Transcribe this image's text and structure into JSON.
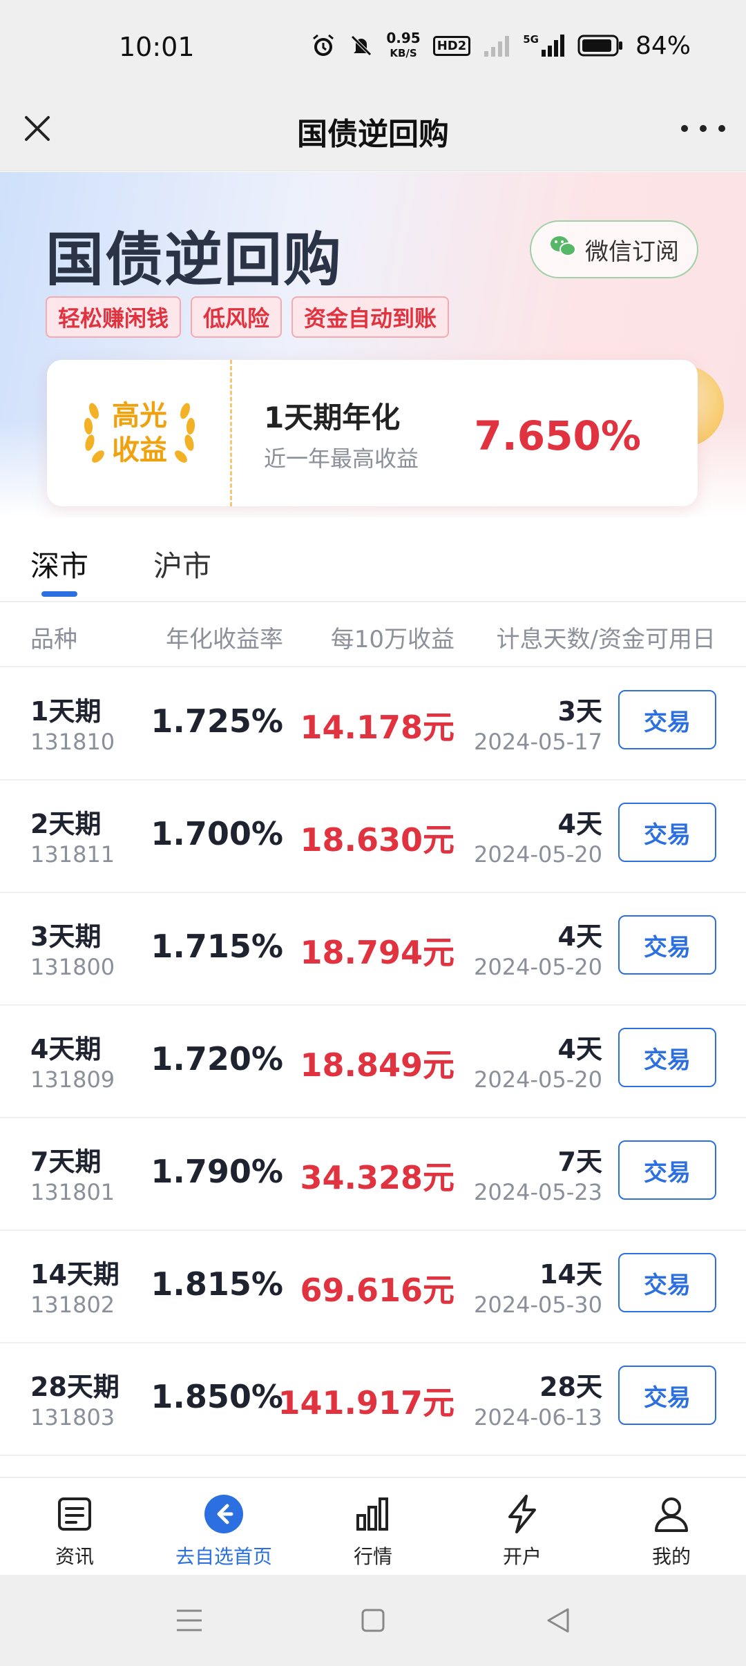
{
  "status_bar": {
    "time": "10:01",
    "speed_value": "0.95",
    "speed_unit": "KB/S",
    "hd_label": "HD2",
    "network_label": "5G",
    "battery": "84%"
  },
  "header": {
    "title": "国债逆回购"
  },
  "banner": {
    "title": "国债逆回购",
    "wechat_label": "微信订阅",
    "tags": [
      "轻松赚闲钱",
      "低风险",
      "资金自动到账"
    ],
    "badge_line1": "高光",
    "badge_line2": "收益",
    "yield_label": "1天期年化",
    "yield_sub": "近一年最高收益",
    "yield_rate": "7.650%"
  },
  "markets": {
    "tabs": [
      "深市",
      "沪市"
    ],
    "active_tab": "深市"
  },
  "table": {
    "headers": [
      "品种",
      "年化收益率",
      "每10万收益",
      "计息天数/资金可用日"
    ],
    "trade_label": "交易",
    "rows": [
      {
        "name": "1天期",
        "code": "131810",
        "rate": "1.725%",
        "income": "14.178元",
        "days": "3天",
        "date": "2024-05-17"
      },
      {
        "name": "2天期",
        "code": "131811",
        "rate": "1.700%",
        "income": "18.630元",
        "days": "4天",
        "date": "2024-05-20"
      },
      {
        "name": "3天期",
        "code": "131800",
        "rate": "1.715%",
        "income": "18.794元",
        "days": "4天",
        "date": "2024-05-20"
      },
      {
        "name": "4天期",
        "code": "131809",
        "rate": "1.720%",
        "income": "18.849元",
        "days": "4天",
        "date": "2024-05-20"
      },
      {
        "name": "7天期",
        "code": "131801",
        "rate": "1.790%",
        "income": "34.328元",
        "days": "7天",
        "date": "2024-05-23"
      },
      {
        "name": "14天期",
        "code": "131802",
        "rate": "1.815%",
        "income": "69.616元",
        "days": "14天",
        "date": "2024-05-30"
      },
      {
        "name": "28天期",
        "code": "131803",
        "rate": "1.850%",
        "income": "141.917元",
        "days": "28天",
        "date": "2024-06-13"
      }
    ]
  },
  "bottom_nav": {
    "items": [
      {
        "label": "资讯",
        "icon": "news-icon"
      },
      {
        "label": "去自选首页",
        "icon": "back-arrow-icon"
      },
      {
        "label": "行情",
        "icon": "bar-chart-icon"
      },
      {
        "label": "开户",
        "icon": "lightning-icon"
      },
      {
        "label": "我的",
        "icon": "user-icon"
      }
    ],
    "active_index": 1
  },
  "colors": {
    "accent_blue": "#2b6fe0",
    "accent_red": "#e0323f",
    "gold": "#f0a10e"
  }
}
